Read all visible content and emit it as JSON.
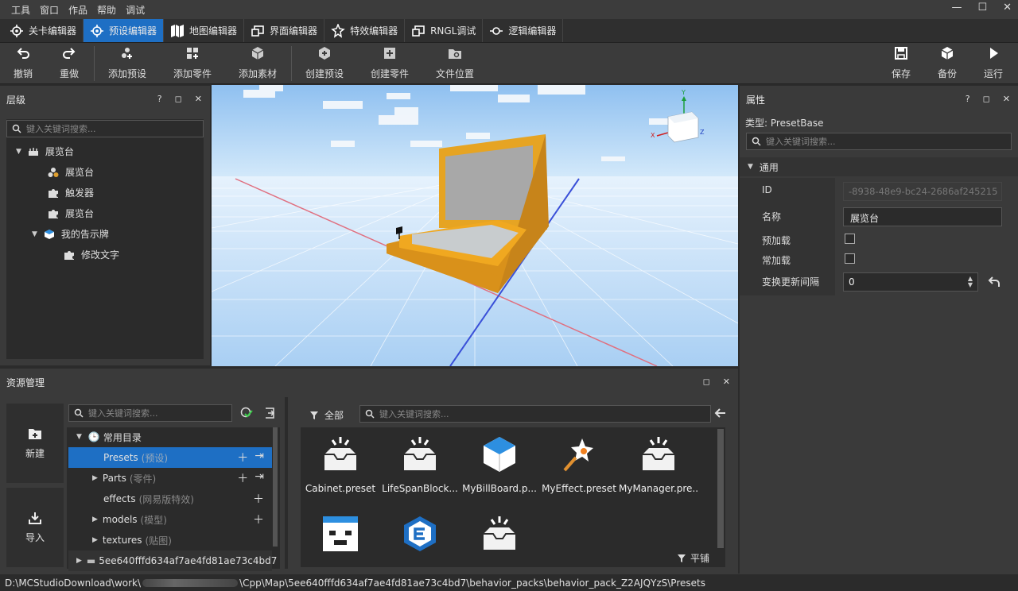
{
  "menu": [
    "工具",
    "窗口",
    "作品",
    "帮助",
    "调试"
  ],
  "window_controls": {
    "minimize": "—",
    "maximize": "☐",
    "close": "✕"
  },
  "editor_tabs": [
    {
      "label": "关卡编辑器",
      "icon": "crosshair-icon",
      "active": false
    },
    {
      "label": "预设编辑器",
      "icon": "crosshair-icon",
      "active": true
    },
    {
      "label": "地图编辑器",
      "icon": "map-icon",
      "active": false
    },
    {
      "label": "界面编辑器",
      "icon": "window-icon",
      "active": false
    },
    {
      "label": "特效编辑器",
      "icon": "sparkle-icon",
      "active": false
    },
    {
      "label": "RNGL调试",
      "icon": "window-icon",
      "active": false
    },
    {
      "label": "逻辑编辑器",
      "icon": "node-icon",
      "active": false
    }
  ],
  "toolbar": {
    "undo": "撤销",
    "redo": "重做",
    "add_preset": "添加预设",
    "add_part": "添加零件",
    "add_asset": "添加素材",
    "create_preset": "创建预设",
    "create_part": "创建零件",
    "file_location": "文件位置",
    "save": "保存",
    "backup": "备份",
    "run": "运行"
  },
  "hierarchy": {
    "title": "层级",
    "search_placeholder": "键入关键词搜索...",
    "nodes": [
      {
        "label": "展览台",
        "icon": "preset-root-icon"
      },
      {
        "label": "展览台",
        "icon": "blocks-icon"
      },
      {
        "label": "触发器",
        "icon": "puzzle-icon"
      },
      {
        "label": "展览台",
        "icon": "puzzle-icon"
      },
      {
        "label": "我的告示牌",
        "icon": "cube-icon"
      },
      {
        "label": "修改文字",
        "icon": "puzzle-icon"
      }
    ]
  },
  "viewport": {
    "gizmo": {
      "y": "Y",
      "x": "X",
      "z": "Z"
    }
  },
  "properties": {
    "title": "属性",
    "type_label": "类型:",
    "type_value": "PresetBase",
    "search_placeholder": "键入关键词搜索...",
    "section": "通用",
    "id_label": "ID",
    "id_value": "-8938-48e9-bc24-2686af245215",
    "name_label": "名称",
    "name_value": "展览台",
    "preload_label": "预加载",
    "persistent_label": "常加载",
    "interval_label": "变换更新间隔",
    "interval_value": "0"
  },
  "assets": {
    "title": "资源管理",
    "new_button": "新建",
    "import_button": "导入",
    "tree_search_placeholder": "键入关键词搜索...",
    "filter_label": "全部",
    "content_search_placeholder": "键入关键词搜索...",
    "folders": [
      {
        "label": "常用目录",
        "sub": ""
      },
      {
        "label": "Presets",
        "sub": "(预设)"
      },
      {
        "label": "Parts",
        "sub": "(零件)"
      },
      {
        "label": "effects",
        "sub": "(网易版特效)"
      },
      {
        "label": "models",
        "sub": "(模型)"
      },
      {
        "label": "textures",
        "sub": "(贴图)"
      },
      {
        "label": "5ee640fffd634af7ae4fd81ae73c4bd7",
        "sub": ""
      }
    ],
    "items": [
      {
        "label": "Cabinet.preset",
        "icon": "tray-icon"
      },
      {
        "label": "LifeSpanBlock...",
        "icon": "tray-icon"
      },
      {
        "label": "MyBillBoard.p...",
        "icon": "cube-icon"
      },
      {
        "label": "MyEffect.preset",
        "icon": "magic-wand-icon"
      },
      {
        "label": "MyManager.pre...",
        "icon": "tray-icon"
      },
      {
        "label": "",
        "icon": "face-icon"
      },
      {
        "label": "",
        "icon": "e-logo-icon"
      },
      {
        "label": "",
        "icon": "tray-icon"
      }
    ],
    "view_mode": "平铺"
  },
  "status_bar": {
    "path_start": "D:\\MCStudioDownload\\work\\",
    "path_end": "\\Cpp\\Map\\5ee640fffd634af7ae4fd81ae73c4bd7\\behavior_packs\\behavior_pack_Z2AJQYzS\\Presets"
  }
}
